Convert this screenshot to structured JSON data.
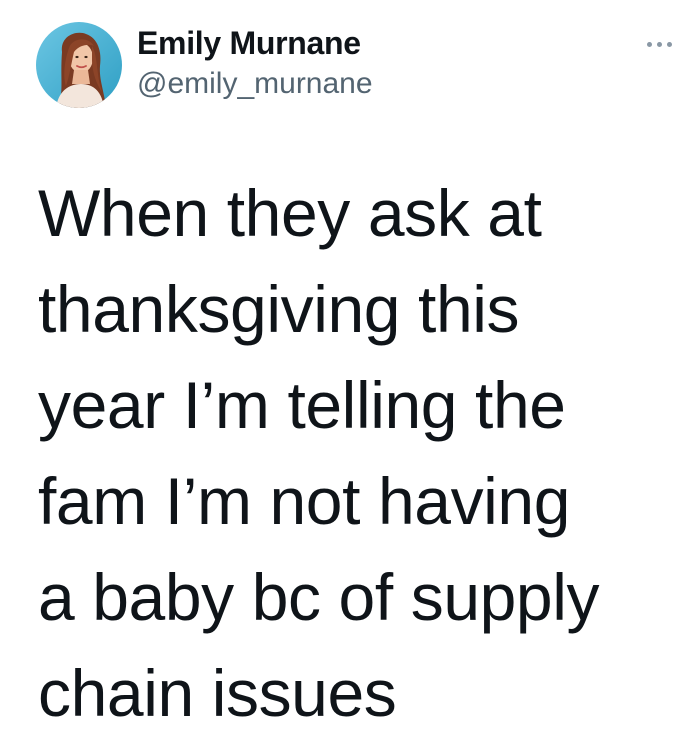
{
  "author": {
    "display_name": "Emily Murnane",
    "handle": "@emily_murnane",
    "avatar_icon": "profile-photo"
  },
  "menu": {
    "icon": "more-horizontal-icon"
  },
  "tweet": {
    "text": "When they ask at\nthanksgiving this\nyear I’m telling the\nfam I’m not having\na baby bc of supply\nchain issues"
  },
  "colors": {
    "text_primary": "#0f1419",
    "text_secondary": "#536471",
    "avatar_bg": "#4ab3d6",
    "background": "#ffffff"
  }
}
